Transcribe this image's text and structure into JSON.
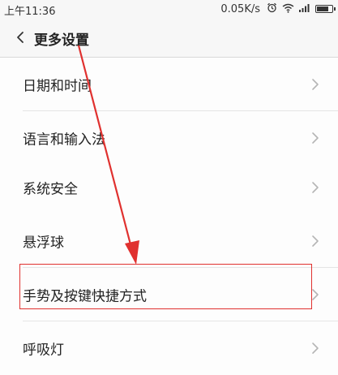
{
  "status_bar": {
    "time": "上午11:36",
    "network_speed": "0.05K/s",
    "icons": [
      "alarm-icon",
      "wifi-icon",
      "signal-icon",
      "battery-icon"
    ],
    "battery_level": 0.8
  },
  "header": {
    "title": "更多设置",
    "back_icon": "chevron-left-icon"
  },
  "groups": [
    {
      "items": [
        {
          "label": "日期和时间"
        },
        {
          "label": "语言和输入法"
        }
      ]
    },
    {
      "items": [
        {
          "label": "系统安全"
        }
      ]
    },
    {
      "items": [
        {
          "label": "悬浮球"
        },
        {
          "label": "手势及按键快捷方式"
        },
        {
          "label": "呼吸灯"
        }
      ]
    }
  ],
  "annotation": {
    "color": "#e0312f",
    "target": "手势及按键快捷方式"
  },
  "colors": {
    "background": "#f2f2f2",
    "row_background": "#fdfdfd",
    "chevron": "#b5b5b5"
  }
}
